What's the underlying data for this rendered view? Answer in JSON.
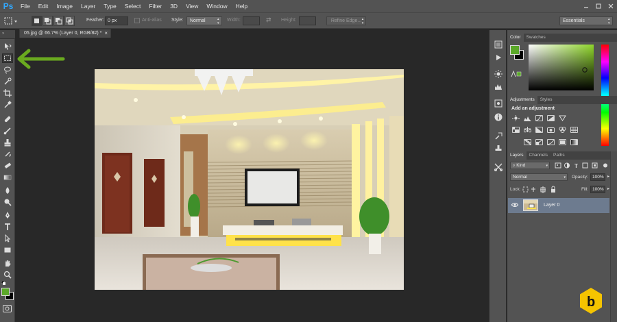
{
  "app": {
    "logo": "Ps"
  },
  "menu": [
    "File",
    "Edit",
    "Image",
    "Layer",
    "Type",
    "Select",
    "Filter",
    "3D",
    "View",
    "Window",
    "Help"
  ],
  "window_controls": [
    "minimize-icon",
    "maximize-icon",
    "close-icon"
  ],
  "options": {
    "feather_label": "Feather:",
    "feather_value": "0 px",
    "antialias_label": "Anti-alias",
    "style_label": "Style:",
    "style_value": "Normal",
    "width_label": "Width:",
    "height_label": "Height:",
    "refine_edge_label": "Refine Edge...",
    "workspace_value": "Essentials"
  },
  "document": {
    "tab_title": "05.jpg @ 66.7% (Layer 0, RGB/8#) *",
    "close_glyph": "×"
  },
  "tools": [
    "move-tool-icon",
    "rectangular-marquee-tool-icon",
    "lasso-tool-icon",
    "quick-selection-tool-icon",
    "crop-tool-icon",
    "eyedropper-tool-icon",
    "spot-healing-brush-icon",
    "brush-tool-icon",
    "clone-stamp-icon",
    "history-brush-icon",
    "eraser-tool-icon",
    "gradient-tool-icon",
    "blur-tool-icon",
    "dodge-tool-icon",
    "pen-tool-icon",
    "type-tool-icon",
    "path-selection-icon",
    "rectangle-tool-icon",
    "hand-tool-icon",
    "zoom-tool-icon"
  ],
  "colors": {
    "foreground": "#5ba829",
    "background": "#000000",
    "picker_hue": "#8fd62a",
    "annotation_arrow": "#6aaa1f",
    "layer_selected": "#6d7b8f",
    "badge_yellow": "#f5c400"
  },
  "panels": {
    "color_tabs": [
      "Color",
      "Swatches"
    ],
    "adjustments_tabs": [
      "Adjustments",
      "Styles"
    ],
    "add_adjustment_label": "Add an adjustment",
    "layers_tabs": [
      "Layers",
      "Channels",
      "Paths"
    ],
    "kind_label": "Kind",
    "blend_mode": "Normal",
    "opacity_label": "Opacity:",
    "opacity_value": "100%",
    "lock_label": "Lock:",
    "fill_label": "Fill:",
    "fill_value": "100%",
    "layer_name": "Layer 0",
    "badge_letter": "b"
  }
}
